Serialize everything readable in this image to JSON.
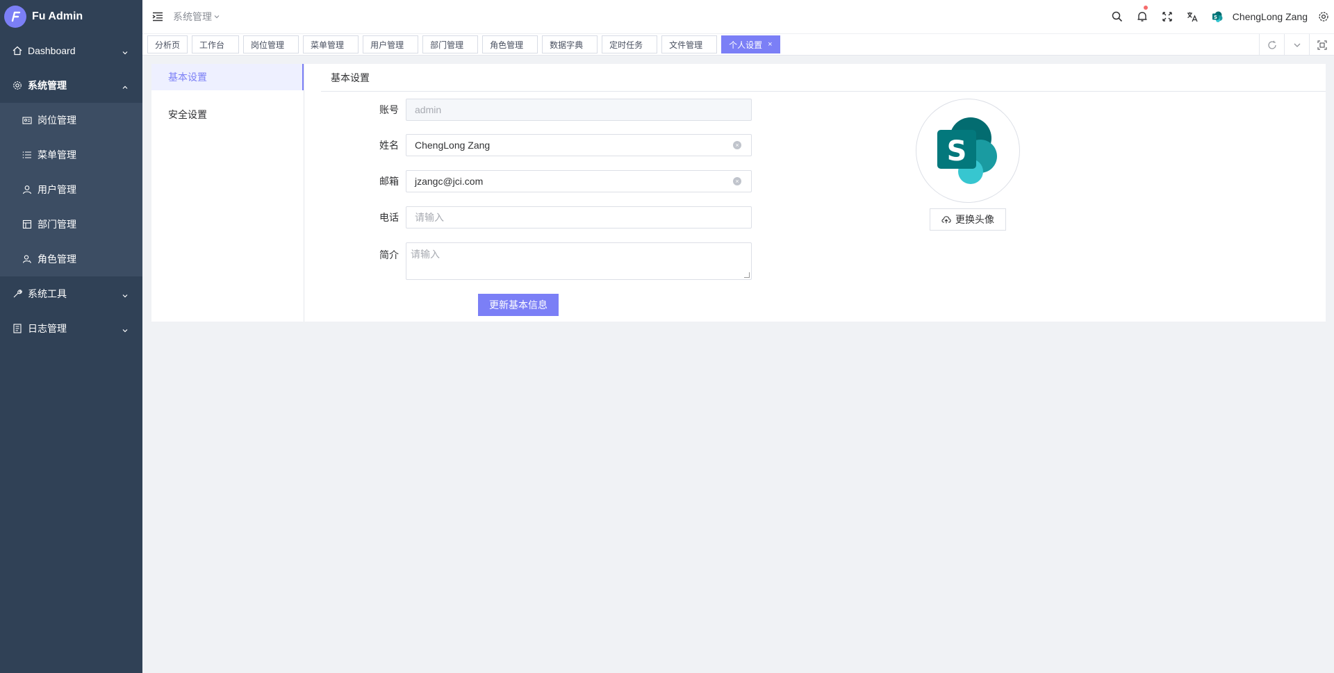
{
  "app": {
    "name": "Fu Admin"
  },
  "sidebar": {
    "items": [
      {
        "label": "Dashboard",
        "icon": "home-icon",
        "expanded": false
      },
      {
        "label": "系统管理",
        "icon": "gear-icon",
        "expanded": true,
        "children": [
          {
            "label": "岗位管理",
            "icon": "id-card-icon"
          },
          {
            "label": "菜单管理",
            "icon": "list-icon"
          },
          {
            "label": "用户管理",
            "icon": "user-icon"
          },
          {
            "label": "部门管理",
            "icon": "building-icon"
          },
          {
            "label": "角色管理",
            "icon": "role-icon"
          }
        ]
      },
      {
        "label": "系统工具",
        "icon": "wrench-icon",
        "expanded": false
      },
      {
        "label": "日志管理",
        "icon": "document-icon",
        "expanded": false
      }
    ]
  },
  "header": {
    "breadcrumb": "系统管理",
    "user_name": "ChengLong Zang"
  },
  "tags": [
    {
      "label": "分析页",
      "active": false
    },
    {
      "label": "工作台",
      "active": false
    },
    {
      "label": "岗位管理",
      "active": false
    },
    {
      "label": "菜单管理",
      "active": false
    },
    {
      "label": "用户管理",
      "active": false
    },
    {
      "label": "部门管理",
      "active": false
    },
    {
      "label": "角色管理",
      "active": false
    },
    {
      "label": "数据字典",
      "active": false
    },
    {
      "label": "定时任务",
      "active": false
    },
    {
      "label": "文件管理",
      "active": false
    },
    {
      "label": "个人设置",
      "active": true,
      "close": "×"
    }
  ],
  "settings": {
    "menu": [
      {
        "label": "基本设置",
        "active": true
      },
      {
        "label": "安全设置",
        "active": false
      }
    ],
    "section_title": "基本设置",
    "form": {
      "account": {
        "label": "账号",
        "value": "admin",
        "disabled": true
      },
      "name": {
        "label": "姓名",
        "value": "ChengLong Zang"
      },
      "email": {
        "label": "邮箱",
        "value": "jzangc@jci.com"
      },
      "phone": {
        "label": "电话",
        "placeholder": "请输入"
      },
      "intro": {
        "label": "简介",
        "placeholder": "请输入"
      }
    },
    "submit_label": "更新基本信息",
    "upload_label": "更换头像"
  },
  "colors": {
    "accent": "#7b7ff6",
    "sidebar_bg": "#304156",
    "submenu_bg": "#3c4d63",
    "notification_dot": "#f56c6c"
  }
}
